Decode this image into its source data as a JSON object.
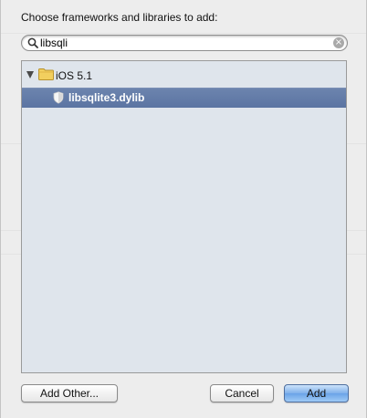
{
  "dialog": {
    "prompt": "Choose frameworks and libraries to add:",
    "search": {
      "value": "libsqli",
      "icon": "magnifier-icon",
      "clear_icon": "clear-search-icon"
    },
    "tree": {
      "group": {
        "label": "iOS 5.1",
        "expanded": true,
        "icon": "folder-icon"
      },
      "items": [
        {
          "label": "libsqlite3.dylib",
          "selected": true,
          "icon": "library-shield-icon"
        }
      ]
    },
    "buttons": {
      "add_other": "Add Other...",
      "cancel": "Cancel",
      "add": "Add"
    }
  },
  "colors": {
    "sheet_bg": "#ededed",
    "list_bg": "#dfe5ec",
    "selection": "#6178a6",
    "default_button": "#7fb0ea"
  }
}
